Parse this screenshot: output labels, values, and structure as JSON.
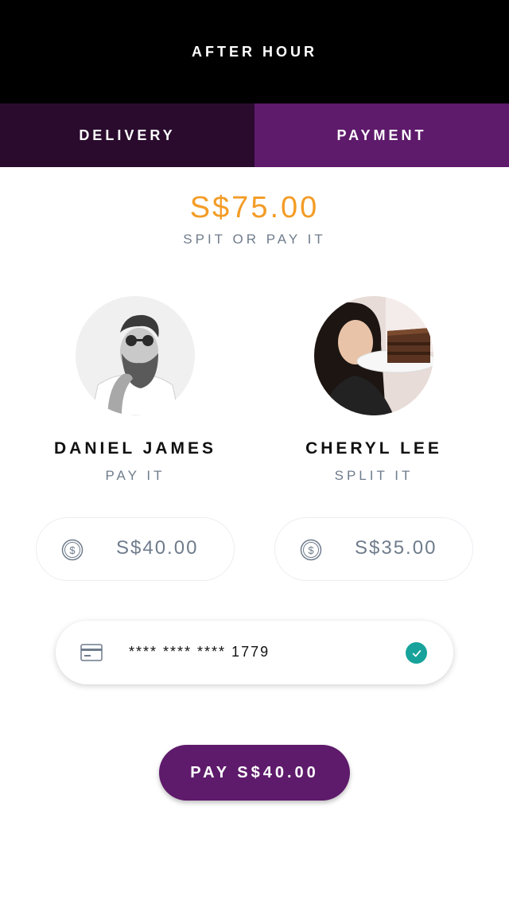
{
  "header": {
    "title": "AFTER HOUR"
  },
  "tabs": [
    {
      "label": "DELIVERY",
      "active": false
    },
    {
      "label": "PAYMENT",
      "active": true
    }
  ],
  "summary": {
    "total": "S$75.00",
    "subtitle": "SPIT OR PAY IT"
  },
  "people": [
    {
      "name": "DANIEL JAMES",
      "mode": "PAY IT",
      "amount": "S$40.00"
    },
    {
      "name": "CHERYL LEE",
      "mode": "SPLIT IT",
      "amount": "S$35.00"
    }
  ],
  "payment_method": {
    "card_number": "**** **** **** 1779",
    "verified": true
  },
  "pay_button": {
    "label": "PAY S$40.00"
  },
  "colors": {
    "header_bg": "#000000",
    "tab_inactive": "#2a0b2e",
    "tab_active": "#5e1a6b",
    "total": "#f39c26",
    "muted_text": "#6f7c8c",
    "check": "#17a39b",
    "button": "#5e1a6b"
  },
  "icons": {
    "amount": "dollar-coin-icon",
    "card": "credit-card-icon",
    "verified": "checkmark-icon"
  }
}
